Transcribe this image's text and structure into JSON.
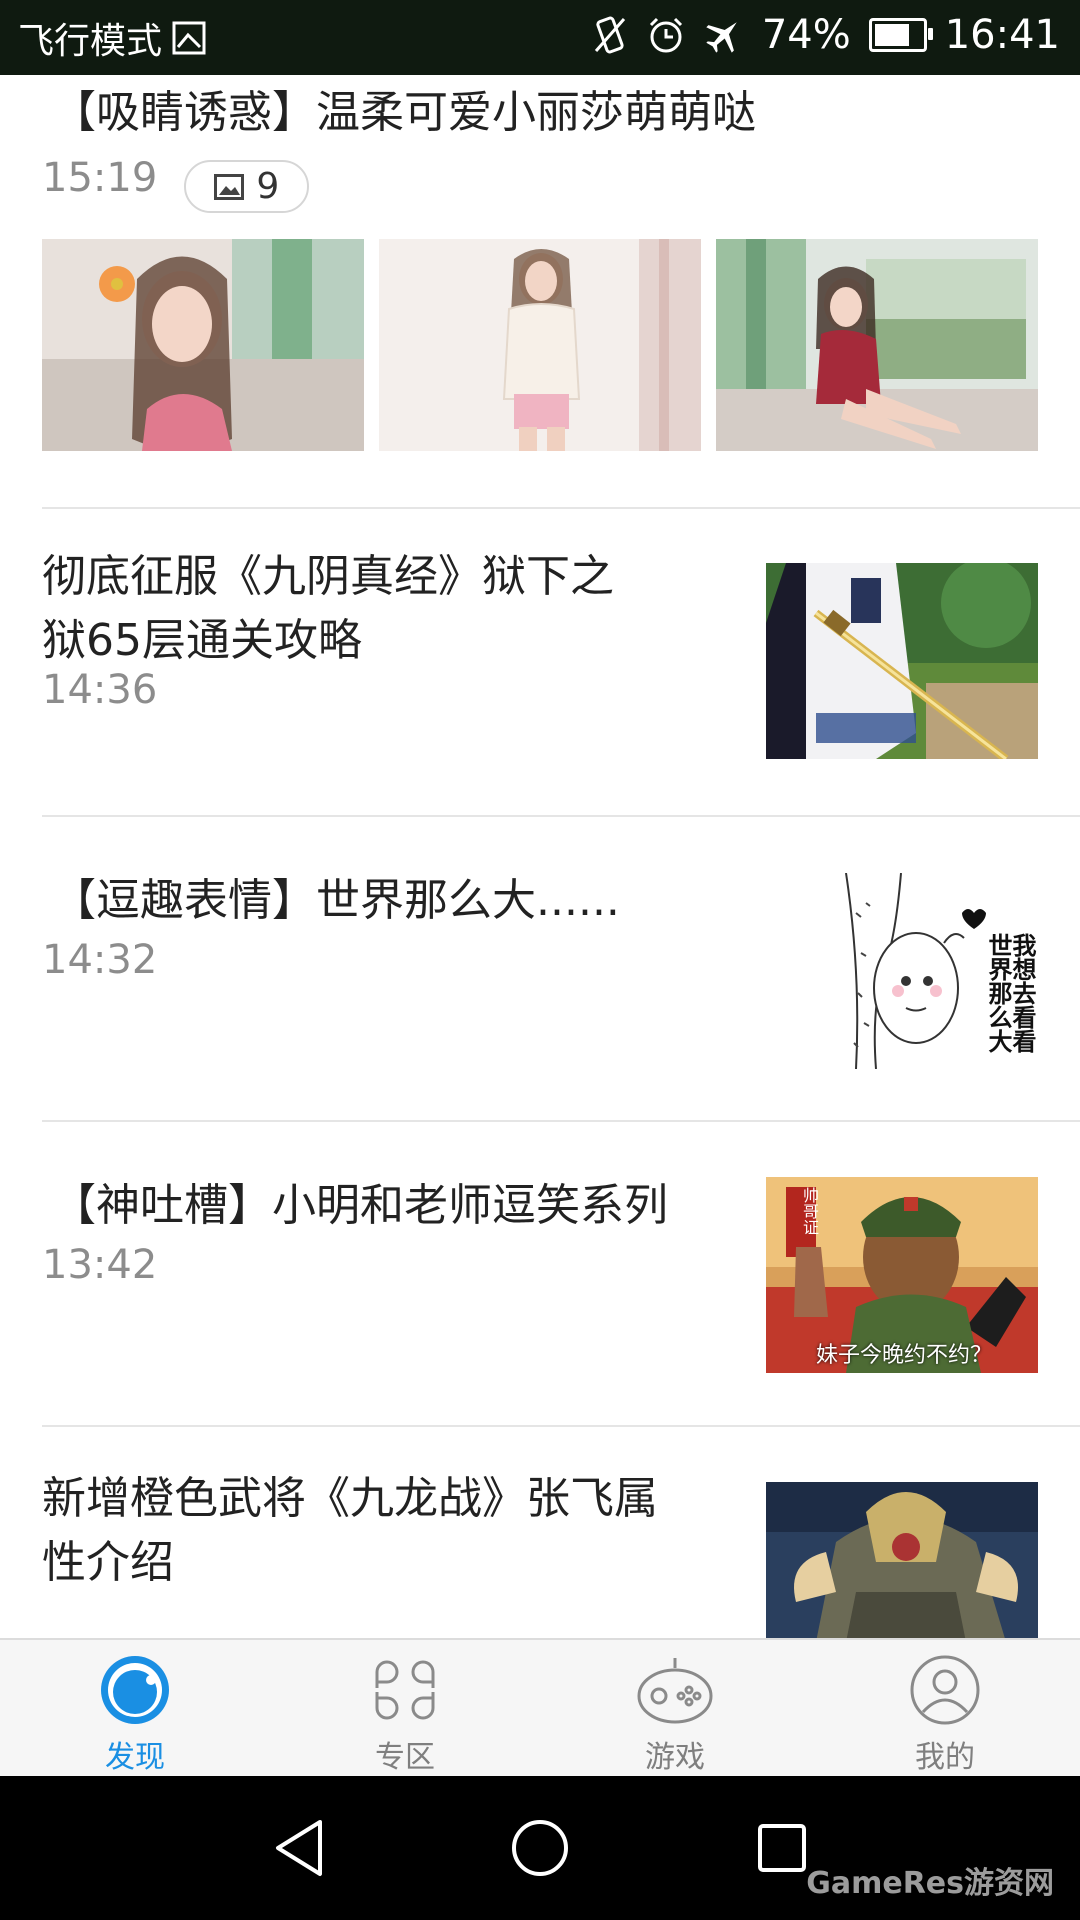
{
  "status_bar": {
    "mode": "飞行模式",
    "battery": "74%",
    "battery_level": 0.74,
    "time": "16:41"
  },
  "feed": [
    {
      "title": "【吸睛诱惑】温柔可爱小丽莎萌萌哒",
      "time": "15:19",
      "image_count": "9"
    },
    {
      "title": "彻底征服《九阴真经》狱下之狱65层通关攻略",
      "title_line1": "彻底征服《九阴真经》狱下之",
      "title_line2": "狱65层通关攻略",
      "time": "14:36"
    },
    {
      "title": "【逗趣表情】世界那么大......",
      "time": "14:32",
      "meme_text": "我想去看看世界那么大"
    },
    {
      "title": "【神吐槽】小明和老师逗笑系列",
      "time": "13:42",
      "poster_caption": "妹子今晚约不约？",
      "poster_tag": "帅哥证"
    },
    {
      "title": "新增橙色武将《九龙战》张飞属性介绍",
      "title_line1": "新增橙色武将《九龙战》张飞属",
      "title_line2": "性介绍"
    }
  ],
  "tabs": [
    {
      "label": "发现",
      "icon": "discover-icon",
      "active": true
    },
    {
      "label": "专区",
      "icon": "grid-icon",
      "active": false
    },
    {
      "label": "游戏",
      "icon": "gamepad-icon",
      "active": false
    },
    {
      "label": "我的",
      "icon": "user-icon",
      "active": false
    }
  ],
  "nav": {
    "back": "back-icon",
    "home": "home-icon",
    "recents": "recents-icon"
  },
  "watermark": "GameRes游资网",
  "colors": {
    "accent": "#1a8fe3",
    "status_bar": "#0f1a10"
  }
}
